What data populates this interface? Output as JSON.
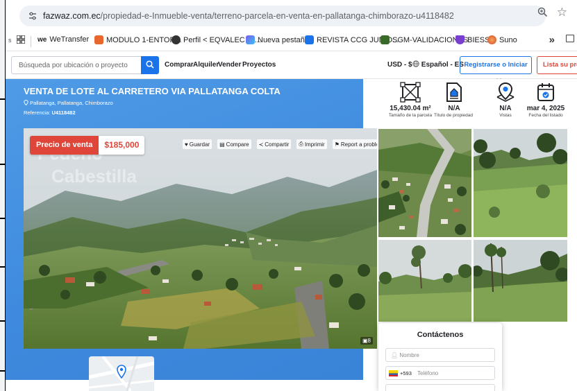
{
  "browser": {
    "site_info_icon": "tune-icon",
    "url_domain": "fazwaz.com.ec",
    "url_path": "/propiedad-e-Inmueble-venta/terreno-parcela-en-venta-en-pallatanga-chimborazo-u4118482",
    "zoom_icon": "zoom-icon",
    "bookmark_star_icon": "star-icon"
  },
  "bookmarks": [
    {
      "label": "WeTransfer",
      "icon": "wetransfer-icon",
      "color": "#222222"
    },
    {
      "label": "MODULO 1-ENTOR...",
      "icon": "module-icon",
      "color": "#e8672c"
    },
    {
      "label": "Perfil < EQVALEC —...",
      "icon": "profile-icon",
      "color": "#333333"
    },
    {
      "label": "Nueva pestaña",
      "icon": "tab-icon",
      "color": "#7a5cf0"
    },
    {
      "label": "REVISTA CCG JUNIO...",
      "icon": "magazine-icon",
      "color": "#1a73e8"
    },
    {
      "label": "SGM-VALIDACIONES",
      "icon": "validation-icon",
      "color": "#3a6a2a"
    },
    {
      "label": "BIESS",
      "icon": "shield-icon",
      "color": "#7b3fd0"
    },
    {
      "label": "Suno",
      "icon": "suno-icon",
      "color": "#f08a3c"
    }
  ],
  "bookmarks_more": "»",
  "site_header": {
    "search_placeholder": "Búsqueda por ubicación o proyecto",
    "nav": [
      "Comprar",
      "Alquiler",
      "Vender",
      "Proyectos"
    ],
    "currency": "USD - $",
    "language": "Español - ES",
    "login": "Registrarse o Iniciar sesión",
    "list_property": "Lista su propiedad"
  },
  "listing": {
    "title": "VENTA DE LOTE AL CARRETERO VIA PALLATANGA COLTA",
    "location": "Pallatanga, Pallatanga, Chimborazo",
    "reference_label": "Referencia:",
    "reference_value": "U4118482",
    "price_label": "Precio de venta",
    "price_value": "$185,000",
    "photo_count": "8"
  },
  "actions": [
    {
      "label": "Guardar",
      "icon": "heart-icon"
    },
    {
      "label": "Compare",
      "icon": "compare-icon"
    },
    {
      "label": "Compartir",
      "icon": "share-icon"
    },
    {
      "label": "Imprimir",
      "icon": "print-icon"
    },
    {
      "label": "Report a problem",
      "icon": "flag-icon"
    }
  ],
  "stats": [
    {
      "value": "15,430.04 m²",
      "label": "Tamaño de la parcela",
      "icon": "land-size-icon"
    },
    {
      "value": "N/A",
      "label": "Título de propiedad de",
      "icon": "title-deed-icon"
    },
    {
      "value": "N/A",
      "label": "Vistas",
      "icon": "map-pin-icon"
    },
    {
      "value": "mar 4, 2025",
      "label": "Fecha del listado",
      "icon": "calendar-icon"
    }
  ],
  "contact": {
    "title": "Contáctenos",
    "name_placeholder": "Nombre",
    "phone_code": "+593",
    "phone_placeholder": "Teléfono"
  },
  "colors": {
    "accent_red": "#e0453a",
    "accent_blue": "#1a73e8",
    "hero_blue": "#3f8ade"
  }
}
